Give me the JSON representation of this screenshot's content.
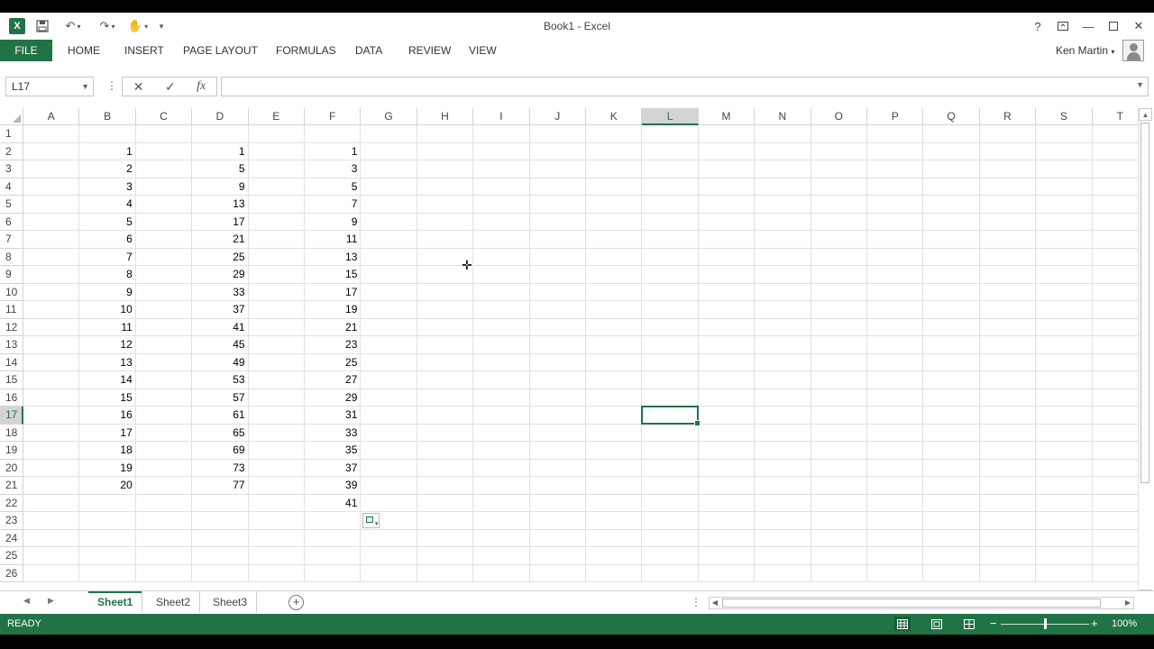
{
  "window": {
    "title": "Book1 - Excel"
  },
  "qat": {
    "app_icon_text": "X",
    "icons": [
      "save-icon",
      "undo-icon",
      "redo-icon",
      "touch-mode-icon",
      "customize-qat-icon"
    ]
  },
  "ribbon": {
    "file": "FILE",
    "tabs": [
      "HOME",
      "INSERT",
      "PAGE LAYOUT",
      "FORMULAS",
      "DATA",
      "REVIEW",
      "VIEW"
    ],
    "user": "Ken Martin"
  },
  "formula_bar": {
    "name_box": "L17",
    "formula": ""
  },
  "grid": {
    "columns": [
      "A",
      "B",
      "C",
      "D",
      "E",
      "F",
      "G",
      "H",
      "I",
      "J",
      "K",
      "L",
      "M",
      "N",
      "O",
      "P",
      "Q",
      "R",
      "S",
      "T"
    ],
    "rows": [
      "1",
      "2",
      "3",
      "4",
      "5",
      "6",
      "7",
      "8",
      "9",
      "10",
      "11",
      "12",
      "13",
      "14",
      "15",
      "16",
      "17",
      "18",
      "19",
      "20",
      "21",
      "22",
      "23",
      "24",
      "25",
      "26"
    ],
    "selected_column": "L",
    "selected_row": "17",
    "cells": {
      "B": [
        "",
        "1",
        "2",
        "3",
        "4",
        "5",
        "6",
        "7",
        "8",
        "9",
        "10",
        "11",
        "12",
        "13",
        "14",
        "15",
        "16",
        "17",
        "18",
        "19",
        "20"
      ],
      "D": [
        "",
        "1",
        "5",
        "9",
        "13",
        "17",
        "21",
        "25",
        "29",
        "33",
        "37",
        "41",
        "45",
        "49",
        "53",
        "57",
        "61",
        "65",
        "69",
        "73",
        "77"
      ],
      "F": [
        "",
        "1",
        "3",
        "5",
        "7",
        "9",
        "11",
        "13",
        "15",
        "17",
        "19",
        "21",
        "23",
        "25",
        "27",
        "29",
        "31",
        "33",
        "35",
        "37",
        "39",
        "41"
      ]
    }
  },
  "sheets": {
    "tabs": [
      "Sheet1",
      "Sheet2",
      "Sheet3"
    ],
    "active": "Sheet1"
  },
  "status": {
    "text": "READY",
    "zoom": "100%",
    "zoom_fraction": 0.5
  },
  "colors": {
    "accent": "#217346"
  }
}
